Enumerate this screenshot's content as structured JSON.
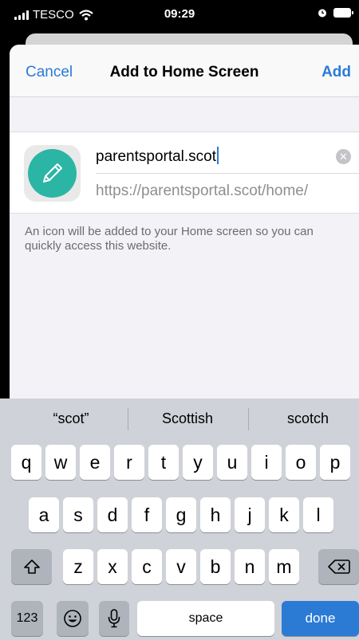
{
  "status_bar": {
    "carrier": "TESCO",
    "time": "09:29"
  },
  "nav": {
    "cancel_label": "Cancel",
    "title": "Add to Home Screen",
    "add_label": "Add"
  },
  "form": {
    "name_value": "parentsportal.scot",
    "url": "https://parentsportal.scot/home/",
    "icon_bg_color": "#2bb5a5"
  },
  "caption": "An icon will be added to your Home screen so you can quickly access this website.",
  "keyboard": {
    "suggestions": [
      "“scot”",
      "Scottish",
      "scotch"
    ],
    "row1": [
      "q",
      "w",
      "e",
      "r",
      "t",
      "y",
      "u",
      "i",
      "o",
      "p"
    ],
    "row2": [
      "a",
      "s",
      "d",
      "f",
      "g",
      "h",
      "j",
      "k",
      "l"
    ],
    "row3": [
      "z",
      "x",
      "c",
      "v",
      "b",
      "n",
      "m"
    ],
    "numbers_label": "123",
    "space_label": "space",
    "done_label": "done"
  }
}
